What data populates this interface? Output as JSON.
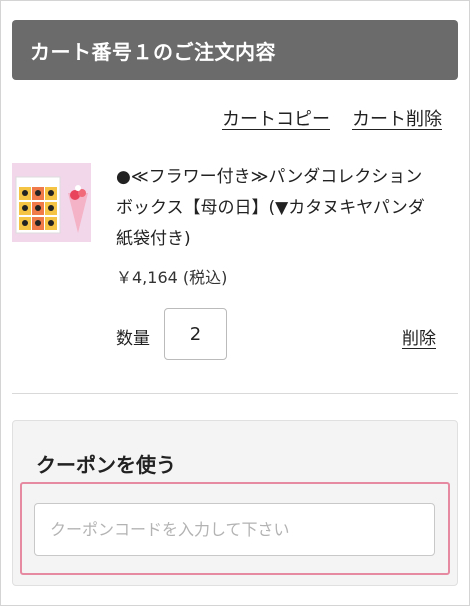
{
  "header": {
    "title": "カート番号１のご注文内容"
  },
  "cart_actions": {
    "copy_label": "カートコピー",
    "delete_cart_label": "カート削除"
  },
  "product": {
    "name": "●≪フラワー付き≫パンダコレクションボックス【母の日】(▼カタヌキヤパンダ紙袋付き)",
    "price": "￥4,164 (税込)",
    "quantity_label": "数量",
    "quantity_value": "2",
    "delete_label": "削除"
  },
  "coupon": {
    "title": "クーポンを使う",
    "placeholder": "クーポンコードを入力して下さい",
    "highlight_color": "#e58aa0"
  },
  "colors": {
    "header_bg": "#6b6b6b",
    "panel_bg": "#f4f4f4"
  }
}
